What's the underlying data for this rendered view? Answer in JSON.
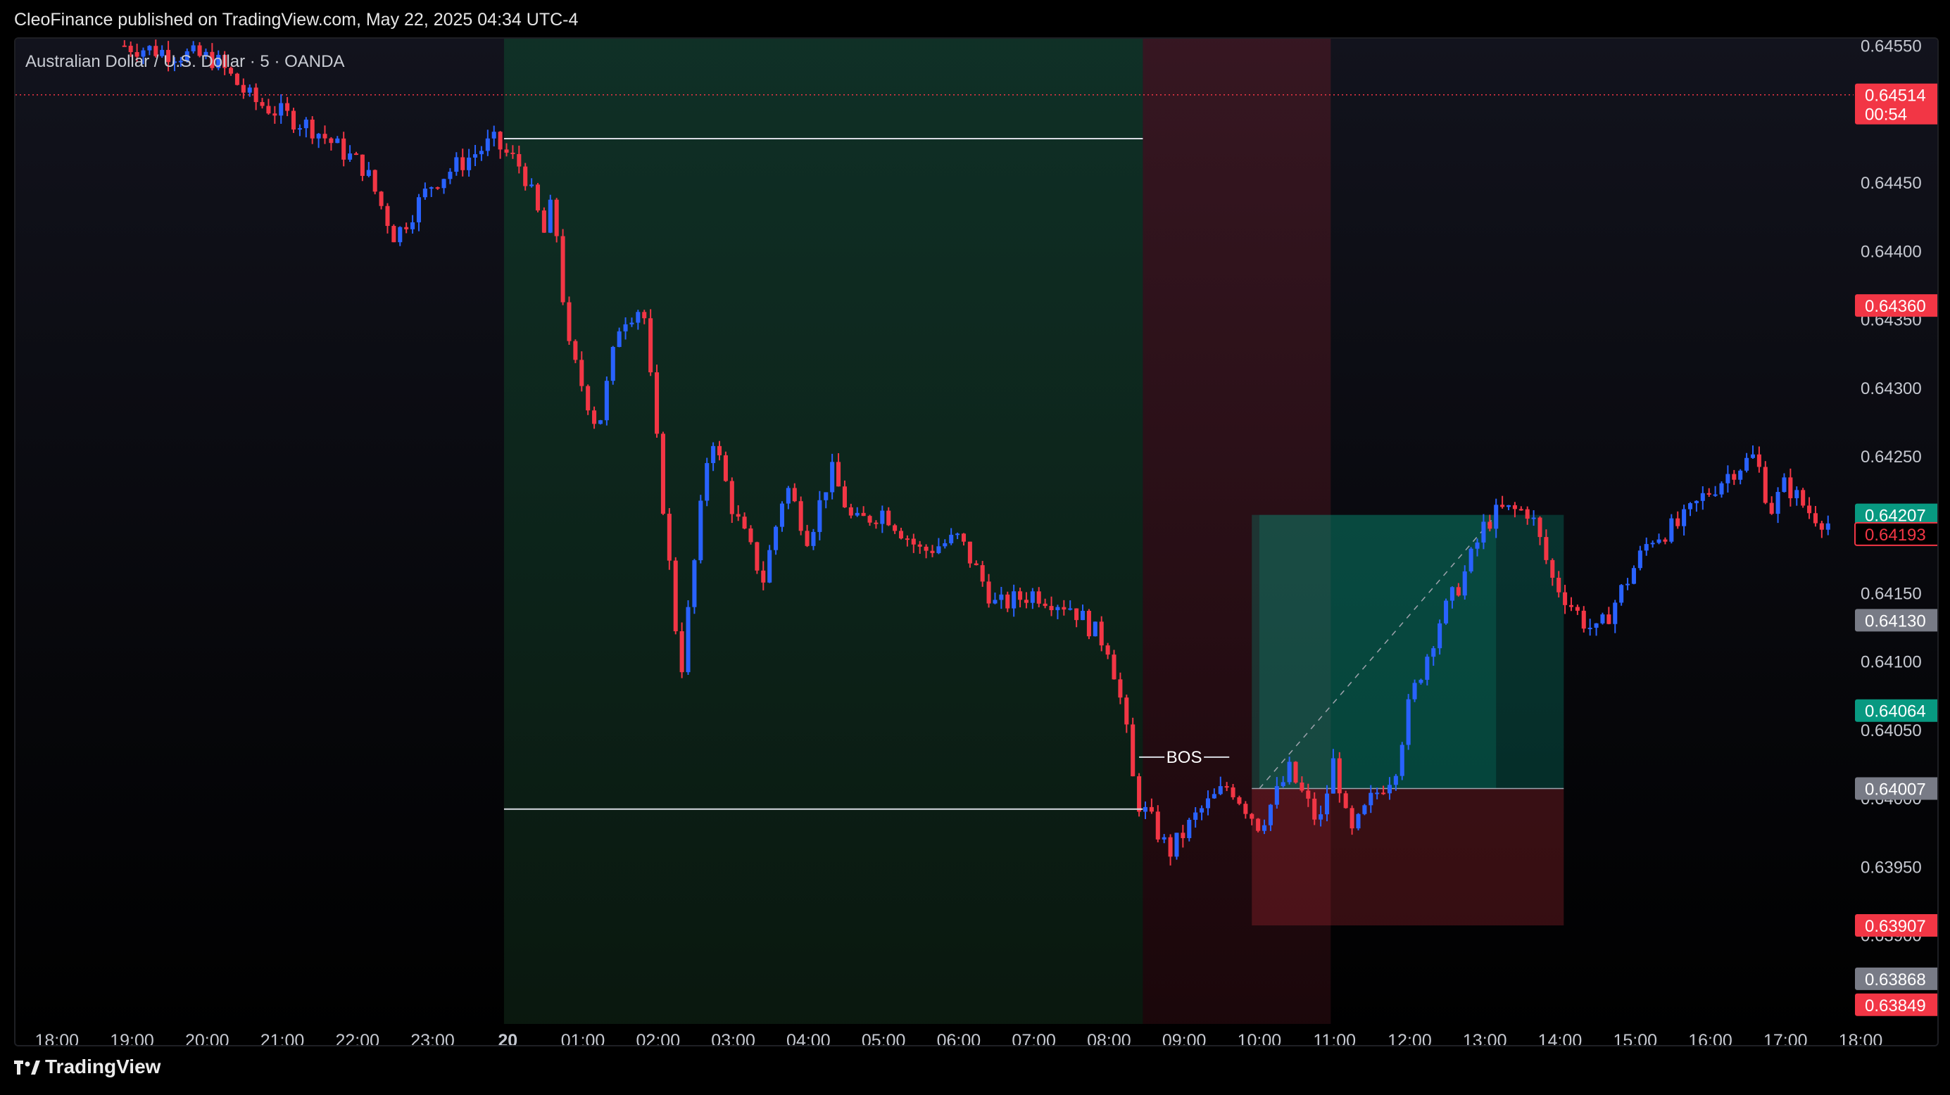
{
  "header": {
    "publisher_line": "CleoFinance published on TradingView.com, May 22, 2025 04:34 UTC-4",
    "symbol_title": "Australian Dollar / U.S. Dollar · 5 · OANDA"
  },
  "footer": {
    "brand": "TradingView",
    "brand_icon": "tradingview-logo-icon"
  },
  "colors": {
    "up_candle": "#2962ff",
    "down_candle": "#f23645",
    "accent_green": "#089981",
    "accent_red": "#f23645",
    "label_gray": "#787b86"
  },
  "chart_data": {
    "type": "candlestick",
    "y_axis": {
      "ylim": [
        0.63835,
        0.64555
      ],
      "ticks": [
        "0.64550",
        "0.64450",
        "0.64400",
        "0.64350",
        "0.64300",
        "0.64250",
        "0.64150",
        "0.64100",
        "0.64050",
        "0.64000",
        "0.63950",
        "0.63900"
      ]
    },
    "x_axis": {
      "xlim": [
        -0.55,
        23.85
      ],
      "ticks": [
        {
          "label": "18:00",
          "x": 0
        },
        {
          "label": "19:00",
          "x": 1
        },
        {
          "label": "20:00",
          "x": 2
        },
        {
          "label": "21:00",
          "x": 3
        },
        {
          "label": "22:00",
          "x": 4
        },
        {
          "label": "23:00",
          "x": 5
        },
        {
          "label": "20",
          "x": 6,
          "bold": true
        },
        {
          "label": "01:00",
          "x": 7
        },
        {
          "label": "02:00",
          "x": 8
        },
        {
          "label": "03:00",
          "x": 9
        },
        {
          "label": "04:00",
          "x": 10
        },
        {
          "label": "05:00",
          "x": 11
        },
        {
          "label": "06:00",
          "x": 12
        },
        {
          "label": "07:00",
          "x": 13
        },
        {
          "label": "08:00",
          "x": 14
        },
        {
          "label": "09:00",
          "x": 15
        },
        {
          "label": "10:00",
          "x": 16
        },
        {
          "label": "11:00",
          "x": 17
        },
        {
          "label": "12:00",
          "x": 18
        },
        {
          "label": "13:00",
          "x": 19
        },
        {
          "label": "14:00",
          "x": 20
        },
        {
          "label": "15:00",
          "x": 21
        },
        {
          "label": "16:00",
          "x": 22
        },
        {
          "label": "17:00",
          "x": 23
        },
        {
          "label": "18:00",
          "x": 24
        }
      ]
    },
    "series_keypoints": [
      [
        0.9,
        0.6455
      ],
      [
        2.1,
        0.6454
      ],
      [
        2.6,
        0.6451
      ],
      [
        3.4,
        0.6449
      ],
      [
        4.1,
        0.6446
      ],
      [
        4.5,
        0.6441
      ],
      [
        5.0,
        0.6445
      ],
      [
        5.8,
        0.6448
      ],
      [
        6.2,
        0.6446
      ],
      [
        6.5,
        0.6441
      ],
      [
        6.6,
        0.6444
      ],
      [
        6.8,
        0.6433
      ],
      [
        7.2,
        0.6427
      ],
      [
        7.5,
        0.6435
      ],
      [
        7.8,
        0.6436
      ],
      [
        8.0,
        0.6425
      ],
      [
        8.3,
        0.6409
      ],
      [
        8.5,
        0.6418
      ],
      [
        8.7,
        0.6427
      ],
      [
        9.0,
        0.6421
      ],
      [
        9.4,
        0.6416
      ],
      [
        9.7,
        0.6423
      ],
      [
        10.0,
        0.6419
      ],
      [
        10.3,
        0.6424
      ],
      [
        10.6,
        0.642
      ],
      [
        11.0,
        0.6421
      ],
      [
        11.5,
        0.6418
      ],
      [
        12.0,
        0.6419
      ],
      [
        12.5,
        0.6414
      ],
      [
        13.0,
        0.6415
      ],
      [
        13.5,
        0.6414
      ],
      [
        14.0,
        0.6411
      ],
      [
        14.2,
        0.6406
      ],
      [
        14.35,
        0.64
      ],
      [
        14.6,
        0.6398
      ],
      [
        14.8,
        0.6396
      ],
      [
        15.2,
        0.6399
      ],
      [
        15.6,
        0.6401
      ],
      [
        16.0,
        0.6398
      ],
      [
        16.4,
        0.6402
      ],
      [
        16.8,
        0.6398
      ],
      [
        17.0,
        0.6403
      ],
      [
        17.2,
        0.6397
      ],
      [
        17.5,
        0.64
      ],
      [
        17.8,
        0.6402
      ],
      [
        18.0,
        0.6407
      ],
      [
        18.4,
        0.6413
      ],
      [
        18.7,
        0.6416
      ],
      [
        19.0,
        0.642
      ],
      [
        19.2,
        0.6421
      ],
      [
        19.6,
        0.6421
      ],
      [
        19.9,
        0.6416
      ],
      [
        20.3,
        0.6413
      ],
      [
        20.5,
        0.6412
      ],
      [
        20.8,
        0.6415
      ],
      [
        21.2,
        0.6419
      ],
      [
        21.6,
        0.642
      ],
      [
        21.9,
        0.6422
      ],
      [
        22.3,
        0.6424
      ],
      [
        22.6,
        0.6425
      ],
      [
        22.8,
        0.6421
      ],
      [
        23.0,
        0.6423
      ],
      [
        23.3,
        0.6421
      ],
      [
        23.6,
        0.642
      ]
    ],
    "last_price_line": 0.64514,
    "zones": [
      {
        "name": "green-session-zone",
        "x": [
          5.95,
          14.45
        ],
        "y": "full",
        "color": "#0e3a2a"
      },
      {
        "name": "red-session-zone",
        "x": [
          14.45,
          16.95
        ],
        "y": "full",
        "color": "#4a1620"
      }
    ],
    "levels": [
      {
        "name": "range-high-line",
        "price": 0.64482,
        "x": [
          5.95,
          14.45
        ]
      },
      {
        "name": "range-low-line",
        "price": 0.63992,
        "x": [
          5.95,
          14.45
        ]
      }
    ],
    "annotations": [
      {
        "name": "bos-label",
        "text": "BOS",
        "x": 15.0,
        "price": 0.6403,
        "line_x": [
          14.4,
          15.6
        ]
      }
    ],
    "position_tool": {
      "x": [
        15.9,
        20.05
      ],
      "entry": 0.64007,
      "target": 0.64207,
      "stop": 0.63907,
      "current": 0.6413,
      "trade_path": [
        [
          16.0,
          0.64007
        ],
        [
          19.15,
          0.64207
        ]
      ]
    },
    "price_labels": [
      {
        "value": "0.64514",
        "sub": "00:54",
        "price": 0.64514,
        "bg": "#f23645",
        "fg": "#ffffff"
      },
      {
        "value": "0.64360",
        "price": 0.6436,
        "bg": "#f23645",
        "fg": "#ffffff"
      },
      {
        "value": "0.64207",
        "price": 0.64207,
        "bg": "#089981",
        "fg": "#ffffff"
      },
      {
        "value": "0.64193",
        "price": 0.64193,
        "bg": "#000000",
        "fg": "#f23645",
        "border": "#f23645"
      },
      {
        "value": "0.64130",
        "price": 0.6413,
        "bg": "#787b86",
        "fg": "#ffffff"
      },
      {
        "value": "0.64064",
        "price": 0.64064,
        "bg": "#089981",
        "fg": "#ffffff"
      },
      {
        "value": "0.64007",
        "price": 0.64007,
        "bg": "#787b86",
        "fg": "#ffffff"
      },
      {
        "value": "0.63907",
        "price": 0.63907,
        "bg": "#f23645",
        "fg": "#ffffff"
      },
      {
        "value": "0.63868",
        "price": 0.63868,
        "bg": "#787b86",
        "fg": "#ffffff"
      },
      {
        "value": "0.63849",
        "price": 0.63849,
        "bg": "#f23645",
        "fg": "#ffffff"
      }
    ]
  }
}
